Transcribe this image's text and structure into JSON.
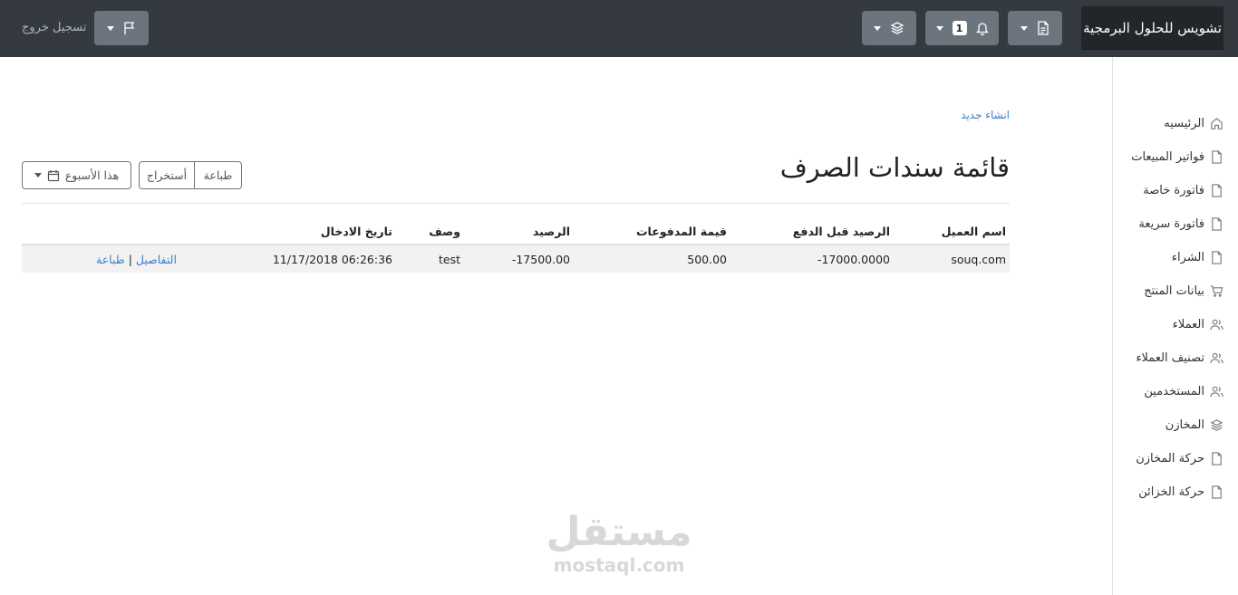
{
  "navbar": {
    "brand": "تشويس للحلول البرمجية",
    "notification_count": "1",
    "logout": "تسجيل خروج",
    "icons": [
      "file-icon",
      "bell-icon",
      "layers-icon",
      "flag-icon"
    ]
  },
  "sidebar": {
    "items": [
      {
        "label": "الرئيسيه",
        "icon": "home-icon"
      },
      {
        "label": "فواتير المبيعات",
        "icon": "file-icon"
      },
      {
        "label": "فاتورة خاصة",
        "icon": "file-icon"
      },
      {
        "label": "فاتورة سريعة",
        "icon": "file-icon"
      },
      {
        "label": "الشراء",
        "icon": "file-icon"
      },
      {
        "label": "بيانات المنتج",
        "icon": "cart-icon"
      },
      {
        "label": "العملاء",
        "icon": "users-icon"
      },
      {
        "label": "تصنيف العملاء",
        "icon": "users-icon"
      },
      {
        "label": "المستخدمين",
        "icon": "users-icon"
      },
      {
        "label": "المخازن",
        "icon": "layers-icon"
      },
      {
        "label": "حركة المخازن",
        "icon": "file-icon"
      },
      {
        "label": "حركة الخزائن",
        "icon": "file-icon"
      }
    ]
  },
  "main": {
    "new_link": "انشاء جديد",
    "title": "قائمة سندات الصرف",
    "print_button": "طباعة",
    "export_button": "أستخراج",
    "period_button": "هذا الأسبوع"
  },
  "table": {
    "headers": [
      "اسم العميل",
      "الرصيد قبل الدفع",
      "قيمة المدفوعات",
      "الرصيد",
      "وصف",
      "تاريخ الادخال"
    ],
    "rows": [
      {
        "customer": "souq.com",
        "balance_before": "-17000.0000",
        "payments": "500.00",
        "balance": "-17500.00",
        "description": "test",
        "date": "11/17/2018 06:26:36",
        "details_link": "التفاصيل",
        "separator": "|",
        "print_link": "طباعة"
      }
    ]
  },
  "watermark": {
    "arabic": "مستقل",
    "latin": "mostaql.com"
  },
  "colors": {
    "navbar": "#343a40",
    "brand_bg": "#232629",
    "button_gray": "#6c757d",
    "link": "#3d7cc9",
    "row_bg": "#f2f2f2"
  }
}
